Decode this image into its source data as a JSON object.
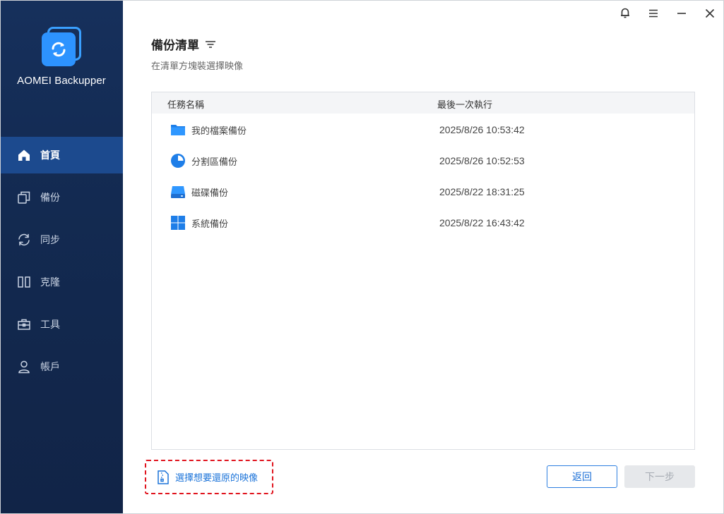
{
  "app": {
    "name": "AOMEI Backupper"
  },
  "sidebar": {
    "items": [
      {
        "label": "首頁",
        "icon": "home-icon",
        "active": true
      },
      {
        "label": "備份",
        "icon": "backup-icon"
      },
      {
        "label": "同步",
        "icon": "sync-icon"
      },
      {
        "label": "克隆",
        "icon": "clone-icon"
      },
      {
        "label": "工具",
        "icon": "toolbox-icon"
      },
      {
        "label": "帳戶",
        "icon": "user-icon"
      }
    ]
  },
  "window": {
    "controls": [
      "bell-icon",
      "menu-icon",
      "minimize-icon",
      "close-icon"
    ]
  },
  "main": {
    "title": "備份清單",
    "subtitle": "在清單方塊裝選擇映像",
    "list": {
      "columns": [
        "任務名稱",
        "最後一次執行"
      ],
      "rows": [
        {
          "name": "我的檔案備份",
          "time": "2025/8/26 10:53:42",
          "icon": "folder-icon"
        },
        {
          "name": "分割區備份",
          "time": "2025/8/26 10:52:53",
          "icon": "partition-icon"
        },
        {
          "name": "磁碟備份",
          "time": "2025/8/22 18:31:25",
          "icon": "disk-icon"
        },
        {
          "name": "系統備份",
          "time": "2025/8/22 16:43:42",
          "icon": "windows-icon"
        }
      ]
    },
    "select_image_label": "選擇想要還原的映像",
    "back_label": "返回",
    "next_label": "下一步"
  },
  "colors": {
    "sidebar": "#132a51",
    "active_nav": "#1c4a8e",
    "accent": "#2d93ff",
    "link": "#1b73d9",
    "highlight_border": "#e0141e"
  }
}
